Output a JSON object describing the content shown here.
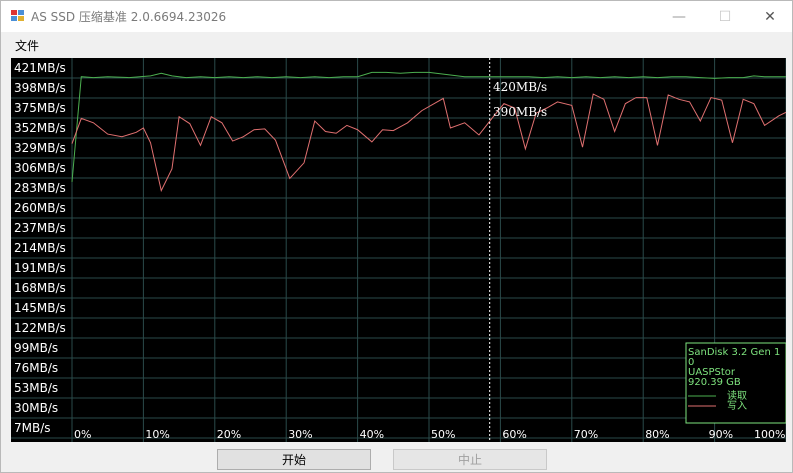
{
  "window": {
    "title": "AS SSD 压缩基准 2.0.6694.23026",
    "minimize_glyph": "—",
    "maximize_glyph": "☐",
    "close_glyph": "✕"
  },
  "menu": {
    "file": "文件"
  },
  "chart_data": {
    "type": "line",
    "y_unit": "MB/s",
    "y_tick_labels": [
      "421MB/s",
      "398MB/s",
      "375MB/s",
      "352MB/s",
      "329MB/s",
      "306MB/s",
      "283MB/s",
      "260MB/s",
      "237MB/s",
      "214MB/s",
      "191MB/s",
      "168MB/s",
      "145MB/s",
      "122MB/s",
      "99MB/s",
      "76MB/s",
      "53MB/s",
      "30MB/s",
      "7MB/s"
    ],
    "y_ticks": [
      421,
      398,
      375,
      352,
      329,
      306,
      283,
      260,
      237,
      214,
      191,
      168,
      145,
      122,
      99,
      76,
      53,
      30,
      7
    ],
    "ylim": [
      7,
      421
    ],
    "x_tick_labels": [
      "0%",
      "10%",
      "20%",
      "30%",
      "40%",
      "50%",
      "60%",
      "70%",
      "80%",
      "90%",
      "100%"
    ],
    "x_ticks": [
      0,
      10,
      20,
      30,
      40,
      50,
      60,
      70,
      80,
      90,
      100
    ],
    "xlim": [
      0,
      100
    ],
    "grid": true,
    "series": [
      {
        "name": "读取",
        "color": "#4caf50",
        "points": [
          [
            0,
            290
          ],
          [
            1.3,
            411
          ],
          [
            3,
            410
          ],
          [
            5,
            411
          ],
          [
            8,
            410
          ],
          [
            11,
            412
          ],
          [
            12.5,
            415
          ],
          [
            14,
            412
          ],
          [
            16,
            410
          ],
          [
            18,
            411
          ],
          [
            20,
            410
          ],
          [
            22,
            411
          ],
          [
            24,
            410
          ],
          [
            26,
            411
          ],
          [
            28,
            410
          ],
          [
            30,
            411
          ],
          [
            32,
            410
          ],
          [
            34,
            411
          ],
          [
            36,
            410
          ],
          [
            38,
            411
          ],
          [
            40,
            411
          ],
          [
            42,
            416
          ],
          [
            44,
            416
          ],
          [
            46,
            415
          ],
          [
            48,
            416
          ],
          [
            50,
            416
          ],
          [
            53,
            413
          ],
          [
            55,
            411
          ],
          [
            57,
            411
          ],
          [
            58.5,
            411
          ],
          [
            60,
            411
          ],
          [
            62,
            411
          ],
          [
            64,
            411
          ],
          [
            66,
            410
          ],
          [
            68,
            411
          ],
          [
            70,
            410
          ],
          [
            72,
            411
          ],
          [
            74,
            410
          ],
          [
            76,
            411
          ],
          [
            78,
            410
          ],
          [
            80,
            411
          ],
          [
            82,
            410
          ],
          [
            84,
            411
          ],
          [
            86,
            411
          ],
          [
            88,
            410
          ],
          [
            90,
            409
          ],
          [
            92,
            410
          ],
          [
            94,
            410
          ],
          [
            95.5,
            412
          ],
          [
            97,
            411
          ],
          [
            99,
            411
          ],
          [
            100,
            411
          ]
        ]
      },
      {
        "name": "写入",
        "color": "#e07070",
        "points": [
          [
            0,
            334
          ],
          [
            1.3,
            363
          ],
          [
            3,
            358
          ],
          [
            5,
            345
          ],
          [
            7,
            342
          ],
          [
            9,
            347
          ],
          [
            10,
            352
          ],
          [
            11,
            335
          ],
          [
            12.5,
            280
          ],
          [
            14,
            305
          ],
          [
            15,
            365
          ],
          [
            16.5,
            357
          ],
          [
            18,
            332
          ],
          [
            19.5,
            365
          ],
          [
            21,
            358
          ],
          [
            22.5,
            337
          ],
          [
            24,
            342
          ],
          [
            25.5,
            350
          ],
          [
            27,
            351
          ],
          [
            28.5,
            338
          ],
          [
            30.5,
            294
          ],
          [
            32.5,
            312
          ],
          [
            34,
            360
          ],
          [
            35.5,
            348
          ],
          [
            37,
            346
          ],
          [
            38.5,
            355
          ],
          [
            40,
            350
          ],
          [
            42,
            336
          ],
          [
            43.5,
            350
          ],
          [
            45,
            349
          ],
          [
            47,
            358
          ],
          [
            49,
            372
          ],
          [
            52,
            386
          ],
          [
            53,
            352
          ],
          [
            55,
            358
          ],
          [
            57,
            344
          ],
          [
            59,
            365
          ],
          [
            60.5,
            380
          ],
          [
            62,
            375
          ],
          [
            63.5,
            328
          ],
          [
            65,
            369
          ],
          [
            66.5,
            375
          ],
          [
            68,
            382
          ],
          [
            70,
            378
          ],
          [
            71.5,
            330
          ],
          [
            73,
            391
          ],
          [
            74.5,
            385
          ],
          [
            76,
            348
          ],
          [
            77.5,
            380
          ],
          [
            79,
            387
          ],
          [
            80.5,
            387
          ],
          [
            82,
            332
          ],
          [
            83.5,
            390
          ],
          [
            85,
            385
          ],
          [
            86.5,
            382
          ],
          [
            88,
            360
          ],
          [
            89.5,
            387
          ],
          [
            91,
            384
          ],
          [
            92.5,
            335
          ],
          [
            94,
            385
          ],
          [
            95.5,
            380
          ],
          [
            97,
            355
          ],
          [
            99,
            366
          ],
          [
            100,
            370
          ]
        ]
      }
    ],
    "cursor_x": 58.5,
    "annotations": [
      "420MB/s",
      "390MB/s"
    ],
    "info_box": {
      "device_line1": "SanDisk 3.2 Gen 1",
      "device_line2": "0",
      "driver": "UASPStor",
      "capacity": "920.39 GB",
      "legend_read": "读取",
      "legend_write": "写入"
    }
  },
  "buttons": {
    "start": "开始",
    "stop": "中止"
  }
}
